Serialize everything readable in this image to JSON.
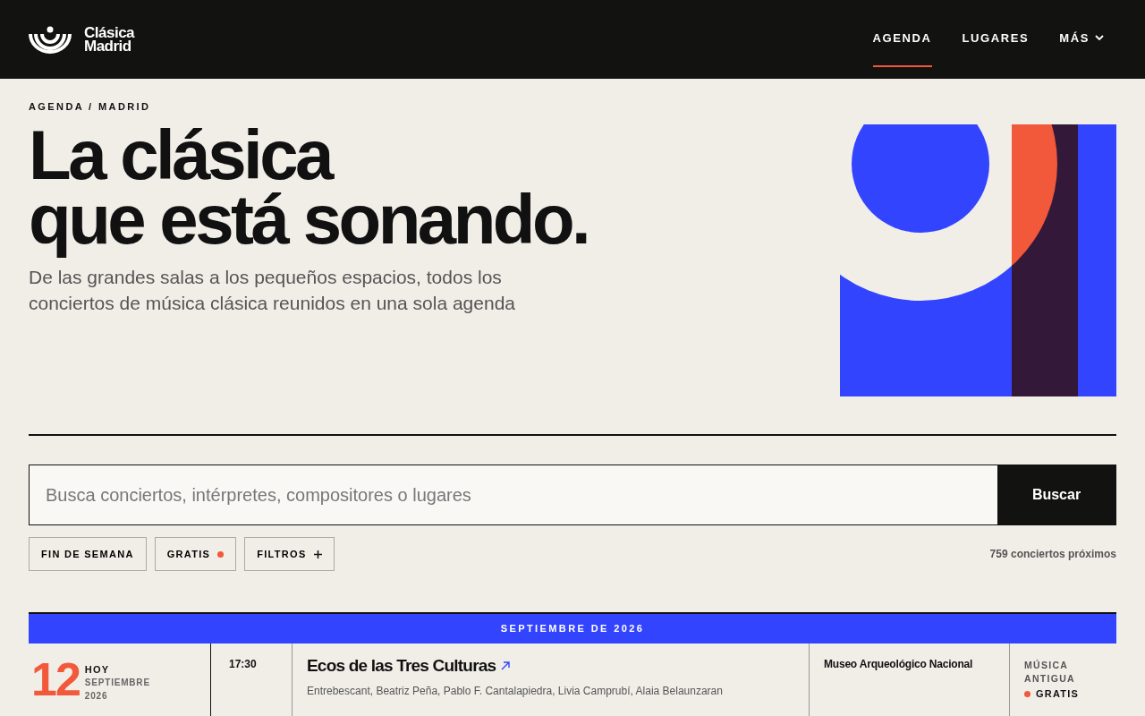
{
  "header": {
    "logo_lines": [
      "Clásica",
      "Madrid"
    ],
    "nav": [
      {
        "label": "AGENDA",
        "selected": true,
        "dropdown": false
      },
      {
        "label": "LUGARES",
        "selected": false,
        "dropdown": false
      },
      {
        "label": "MÁS",
        "selected": false,
        "dropdown": true
      }
    ]
  },
  "hero": {
    "breadcrumb": "AGENDA / MADRID",
    "title_lines": [
      "La clásica",
      "que está sonando."
    ],
    "subtitle": "De las grandes salas a los pequeños espacios, todos los conciertos de música clásica reunidos en una sola agenda"
  },
  "search": {
    "placeholder": "Busca conciertos, intérpretes, compositores o lugares",
    "button": "Buscar"
  },
  "filters": [
    {
      "label": "FIN DE SEMANA",
      "kind": "plain",
      "active": false
    },
    {
      "label": "GRATIS",
      "kind": "plain",
      "active": true
    },
    {
      "label": "FILTROS",
      "kind": "expand",
      "active": false
    }
  ],
  "count": "759 conciertos próximos",
  "month": "SEPTIEMBRE DE 2026",
  "events": [
    {
      "day": "12",
      "day_label": "HOY",
      "month": "SEPTIEMBRE",
      "year": "2026",
      "time": "17:30",
      "title": "Ecos de las Tres Culturas",
      "performers": "Entrebescant, Beatriz Peña, Pablo F. Cantalapiedra, Livia Camprubí, Alaia Belaunzaran",
      "venue": "Museo Arqueológico Nacional",
      "genre": "MÚSICA ANTIGUA",
      "free": true,
      "price": "GRATIS"
    }
  ]
}
